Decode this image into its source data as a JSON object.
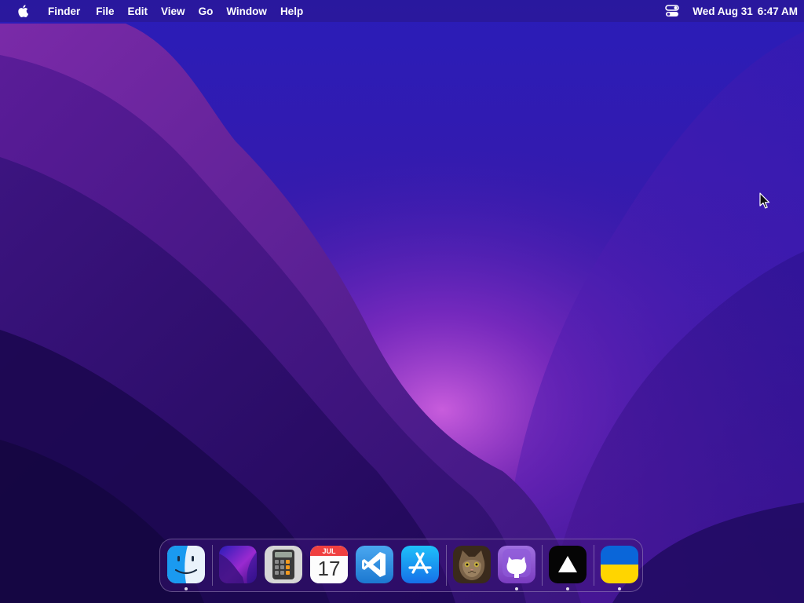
{
  "menubar": {
    "apple_menu": "apple-logo-icon",
    "app_name": "Finder",
    "items": [
      "File",
      "Edit",
      "View",
      "Go",
      "Window",
      "Help"
    ],
    "control_center": "control-center-icon",
    "clock": {
      "date": "Wed Aug 31",
      "time": "6:47 AM"
    }
  },
  "dock": {
    "apps": [
      {
        "icon": "finder-icon",
        "running": true
      },
      {
        "icon": "monterey-wallpaper-icon",
        "running": false
      },
      {
        "icon": "calculator-icon",
        "running": false
      },
      {
        "icon": "calendar-icon",
        "month": "JUL",
        "day": "17",
        "running": false
      },
      {
        "icon": "vscode-icon",
        "running": false
      },
      {
        "icon": "app-store-icon",
        "running": false
      },
      {
        "icon": "cat-photo-icon",
        "running": false
      },
      {
        "icon": "github-desktop-icon",
        "running": true
      },
      {
        "icon": "vercel-triangle-icon",
        "running": true
      },
      {
        "icon": "ukraine-flag-icon",
        "running": true
      }
    ]
  },
  "colors": {
    "wallpaper_base": "#2a0f8a",
    "wallpaper_glow": "#b040d0",
    "calendar_red": "#f04040",
    "vscode_blue": "#2f8fe6",
    "appstore_blue": "#1a8cf5",
    "github_purple": "#8a4fd0",
    "ukraine_blue": "#0a66d9",
    "ukraine_yellow": "#ffd500"
  }
}
